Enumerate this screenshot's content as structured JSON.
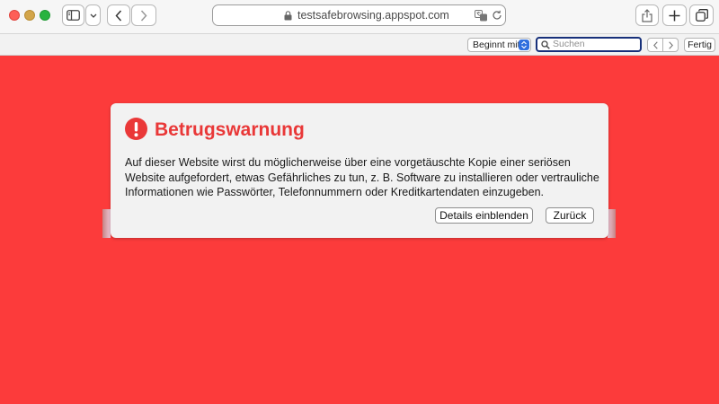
{
  "browser": {
    "url": "testsafebrowsing.appspot.com",
    "icons": {
      "sidebar": "sidebar-icon",
      "back": "chevron-left-icon",
      "forward": "chevron-right-icon",
      "share": "share-icon",
      "new_tab": "plus-icon",
      "tabs": "tab-overview-icon",
      "lock": "lock-icon",
      "translate": "translate-icon",
      "reload": "reload-icon"
    }
  },
  "findbar": {
    "mode_select": "Beginnt mit",
    "search_placeholder": "Suchen",
    "done_label": "Fertig"
  },
  "dialog": {
    "title": "Betrugswarnung",
    "body": "Auf dieser Website wirst du möglicherweise über eine vorgetäuschte Kopie einer seriösen Website aufgefordert, etwas Gefährliches zu tun, z. B. Software zu installieren oder vertrauliche Informationen wie Passwörter, Telefonnummern oder Kreditkartendaten einzugeben.",
    "details_button": "Details einblenden",
    "back_button": "Zurück"
  },
  "colors": {
    "page_background": "#fc3b3b",
    "warning_red": "#e93838",
    "dialog_background": "#f2f2f2"
  }
}
